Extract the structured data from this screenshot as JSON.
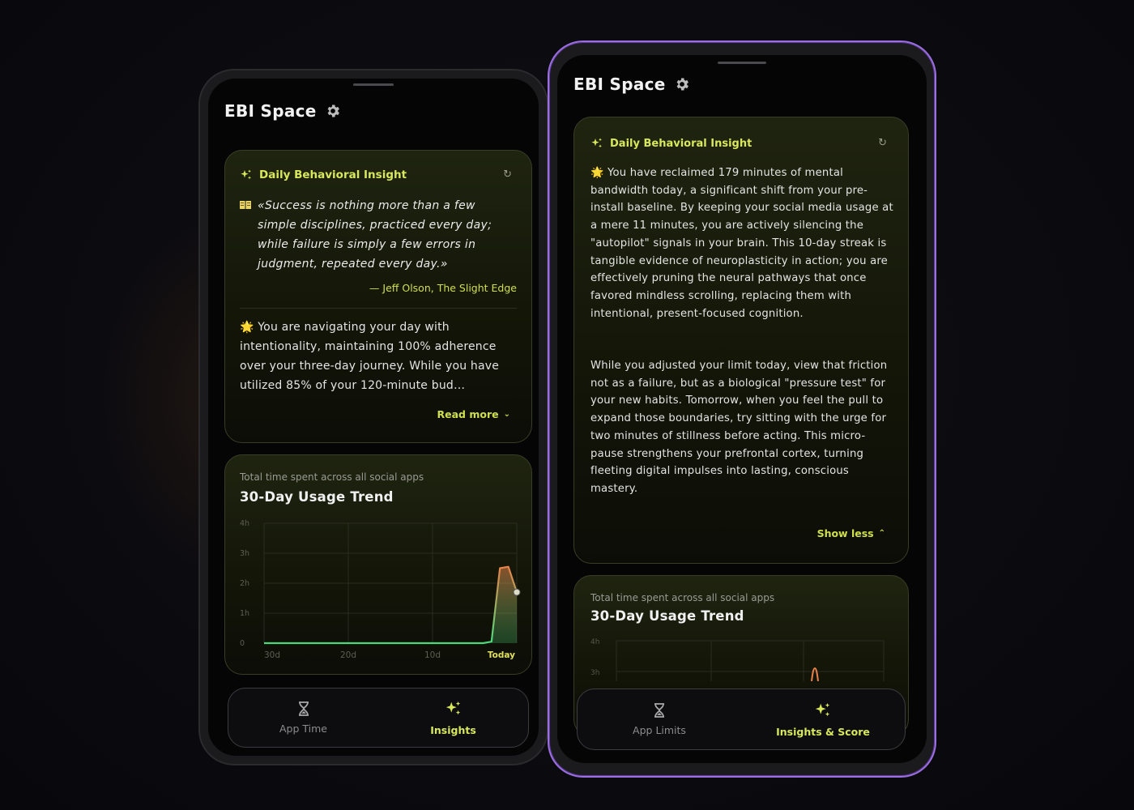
{
  "colors": {
    "accent": "#d8e85a",
    "line_start": "#4cd97a",
    "line_peak": "#e8824a",
    "frame_left": "#2b2b2e",
    "frame_right": "#9b6fe0",
    "screen": "#050506"
  },
  "left_phone": {
    "app_title": "EBI Space",
    "insight": {
      "title": "Daily Behavioral Insight",
      "quote": "«Success is nothing more than a few simple disciplines, practiced every day; while failure is simply a few errors in judgment, repeated every day.»",
      "author": "— Jeff Olson, The Slight Edge",
      "body": "🌟 You are navigating your day with intentionality, maintaining 100% adherence over your three-day journey. While you have utilized 85% of your 120-minute bud…",
      "toggle_label": "Read more"
    },
    "usage": {
      "subtitle": "Total time spent across all social apps",
      "title": "30-Day Usage Trend"
    },
    "tabs": [
      {
        "label": "App Time",
        "icon": "hourglass-icon",
        "active": false
      },
      {
        "label": "Insights",
        "icon": "sparkles-icon",
        "active": true
      }
    ]
  },
  "right_phone": {
    "app_title": "EBI Space",
    "insight": {
      "title": "Daily Behavioral Insight",
      "paragraph1": "🌟 You have reclaimed 179 minutes of mental bandwidth today, a significant shift from your pre-install baseline. By keeping your social media usage at a mere 11 minutes, you are actively silencing the \"autopilot\" signals in your brain. This 10-day streak is tangible evidence of neuroplasticity in action; you are effectively pruning the neural pathways that once favored mindless scrolling, replacing them with intentional, present-focused cognition.",
      "paragraph2": "While you adjusted your limit today, view that friction not as a failure, but as a biological \"pressure test\" for your new habits. Tomorrow, when you feel the pull to expand those boundaries, try sitting with the urge for two minutes of stillness before acting. This micro-pause strengthens your prefrontal cortex, turning fleeting digital impulses into lasting, conscious mastery.",
      "toggle_label": "Show less"
    },
    "usage": {
      "subtitle": "Total time spent across all social apps",
      "title": "30-Day Usage Trend",
      "y_ticks_visible": [
        "4h",
        "3h"
      ]
    },
    "tabs": [
      {
        "label": "App Limits",
        "icon": "hourglass-icon",
        "active": false
      },
      {
        "label": "Insights & Score",
        "icon": "sparkles-icon",
        "active": true
      }
    ]
  },
  "chart_data": {
    "type": "area",
    "title": "30-Day Usage Trend",
    "subtitle": "Total time spent across all social apps",
    "y_ticks": [
      "0",
      "1h",
      "2h",
      "3h",
      "4h"
    ],
    "ylim": [
      0,
      4
    ],
    "y_unit": "hours",
    "x_ticks": [
      "30d",
      "20d",
      "10d",
      "Today"
    ],
    "series": [
      {
        "x": [
          30,
          29,
          28,
          27,
          26,
          25,
          24,
          23,
          22,
          21,
          20,
          19,
          18,
          17,
          16,
          15,
          14,
          13,
          12,
          11,
          10,
          9,
          8,
          7,
          6,
          5,
          4,
          3,
          2,
          1,
          0
        ],
        "values": [
          0,
          0,
          0,
          0,
          0,
          0,
          0,
          0,
          0,
          0,
          0,
          0,
          0,
          0,
          0,
          0,
          0,
          0,
          0,
          0,
          0,
          0,
          0,
          0,
          0,
          0,
          0,
          0.05,
          2.5,
          2.55,
          1.7
        ]
      }
    ],
    "grid": true
  }
}
